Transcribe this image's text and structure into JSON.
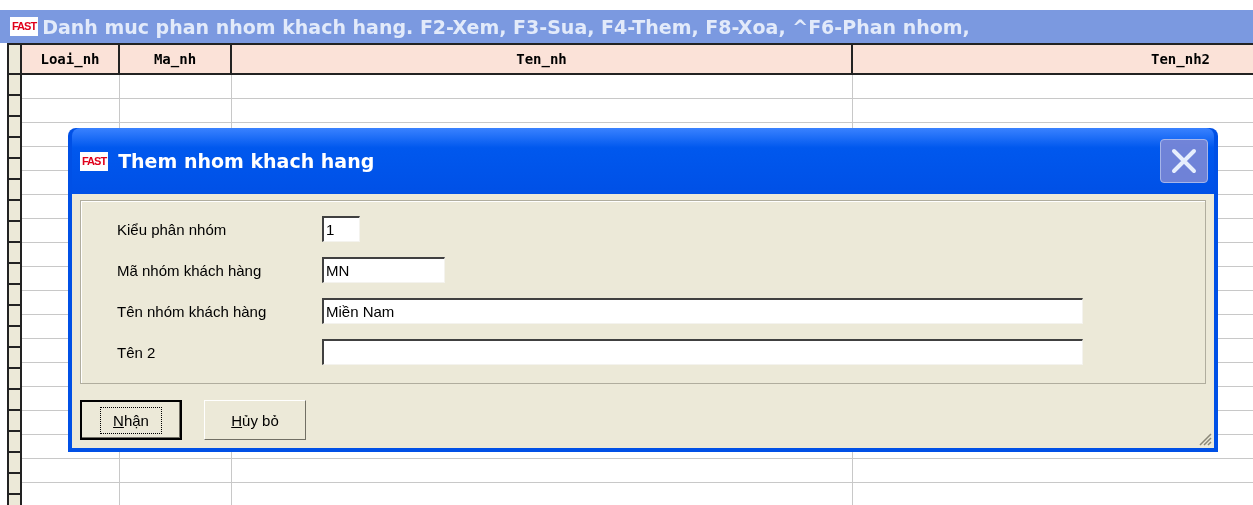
{
  "window": {
    "logo": "FAST",
    "title": "Danh muc phan nhom khach hang. F2-Xem, F3-Sua, F4-Them, F8-Xoa, ^F6-Phan nhom,"
  },
  "table": {
    "columns": [
      "Loai_nh",
      "Ma_nh",
      "Ten_nh",
      "Ten_nh2"
    ]
  },
  "dialog": {
    "logo": "FAST",
    "title": "Them nhom khach hang",
    "close_disabled": true,
    "fields": [
      {
        "label": "Kiểu phân nhóm",
        "value": "1"
      },
      {
        "label": "Mã nhóm khách hàng",
        "value": "MN"
      },
      {
        "label": "Tên nhóm khách hàng",
        "value": "Miền Nam"
      },
      {
        "label": "Tên 2"
      }
    ],
    "buttons": [
      {
        "label": "Nhận",
        "default": true
      },
      {
        "label": "Hủy bỏ",
        "default": false
      }
    ]
  }
}
